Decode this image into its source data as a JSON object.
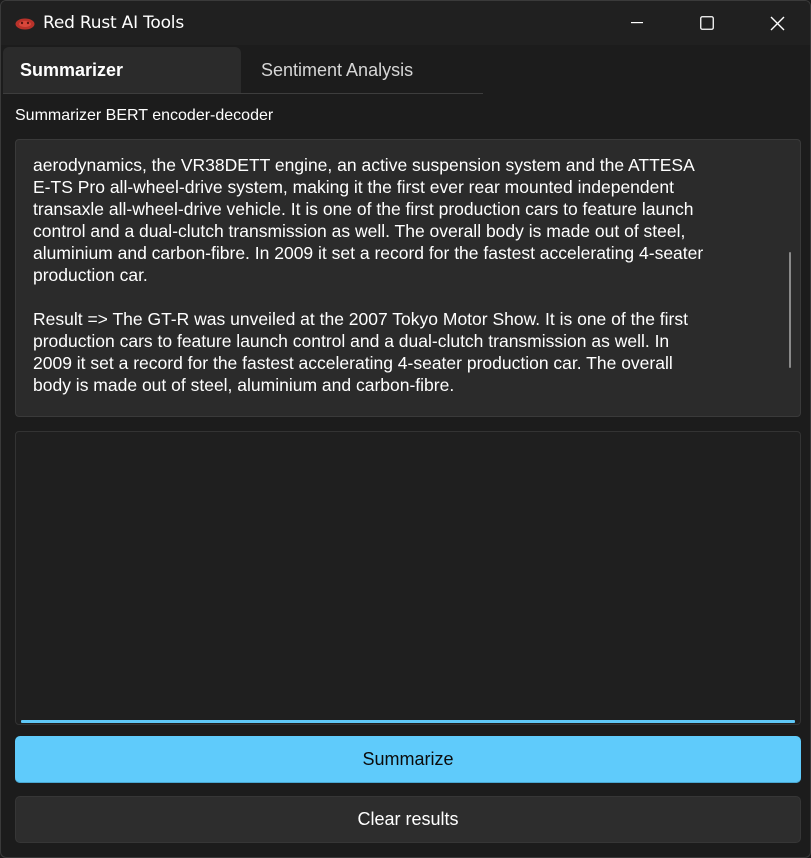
{
  "window": {
    "title": "Red Rust AI Tools",
    "app_icon": "red-rust-logo-icon"
  },
  "tabs": [
    {
      "label": "Summarizer",
      "active": true
    },
    {
      "label": "Sentiment Analysis",
      "active": false
    }
  ],
  "main": {
    "section_label": "Summarizer BERT encoder-decoder",
    "result_text": "aerodynamics, the VR38DETT engine, an active suspension system and the ATTESA\nE-TS Pro all-wheel-drive system, making it the first ever rear mounted independent\ntransaxle all-wheel-drive vehicle. It is one of the first production cars to feature launch\ncontrol and a dual-clutch transmission as well. The overall body is made out of steel,\naluminium and carbon-fibre. In 2009 it set a record for the fastest accelerating 4-seater\nproduction car.\n\nResult => The GT-R was unveiled at the 2007 Tokyo Motor Show. It is one of the first\nproduction cars to feature launch control and a dual-clutch transmission as well. In\n2009 it set a record for the fastest accelerating 4-seater production car. The overall\nbody is made out of steel, aluminium and carbon-fibre.",
    "input_value": "",
    "input_placeholder": ""
  },
  "buttons": {
    "summarize_label": "Summarize",
    "clear_label": "Clear results"
  },
  "colors": {
    "accent": "#5fcbfb",
    "background": "#1c1c1c",
    "panel": "#2b2b2b"
  }
}
